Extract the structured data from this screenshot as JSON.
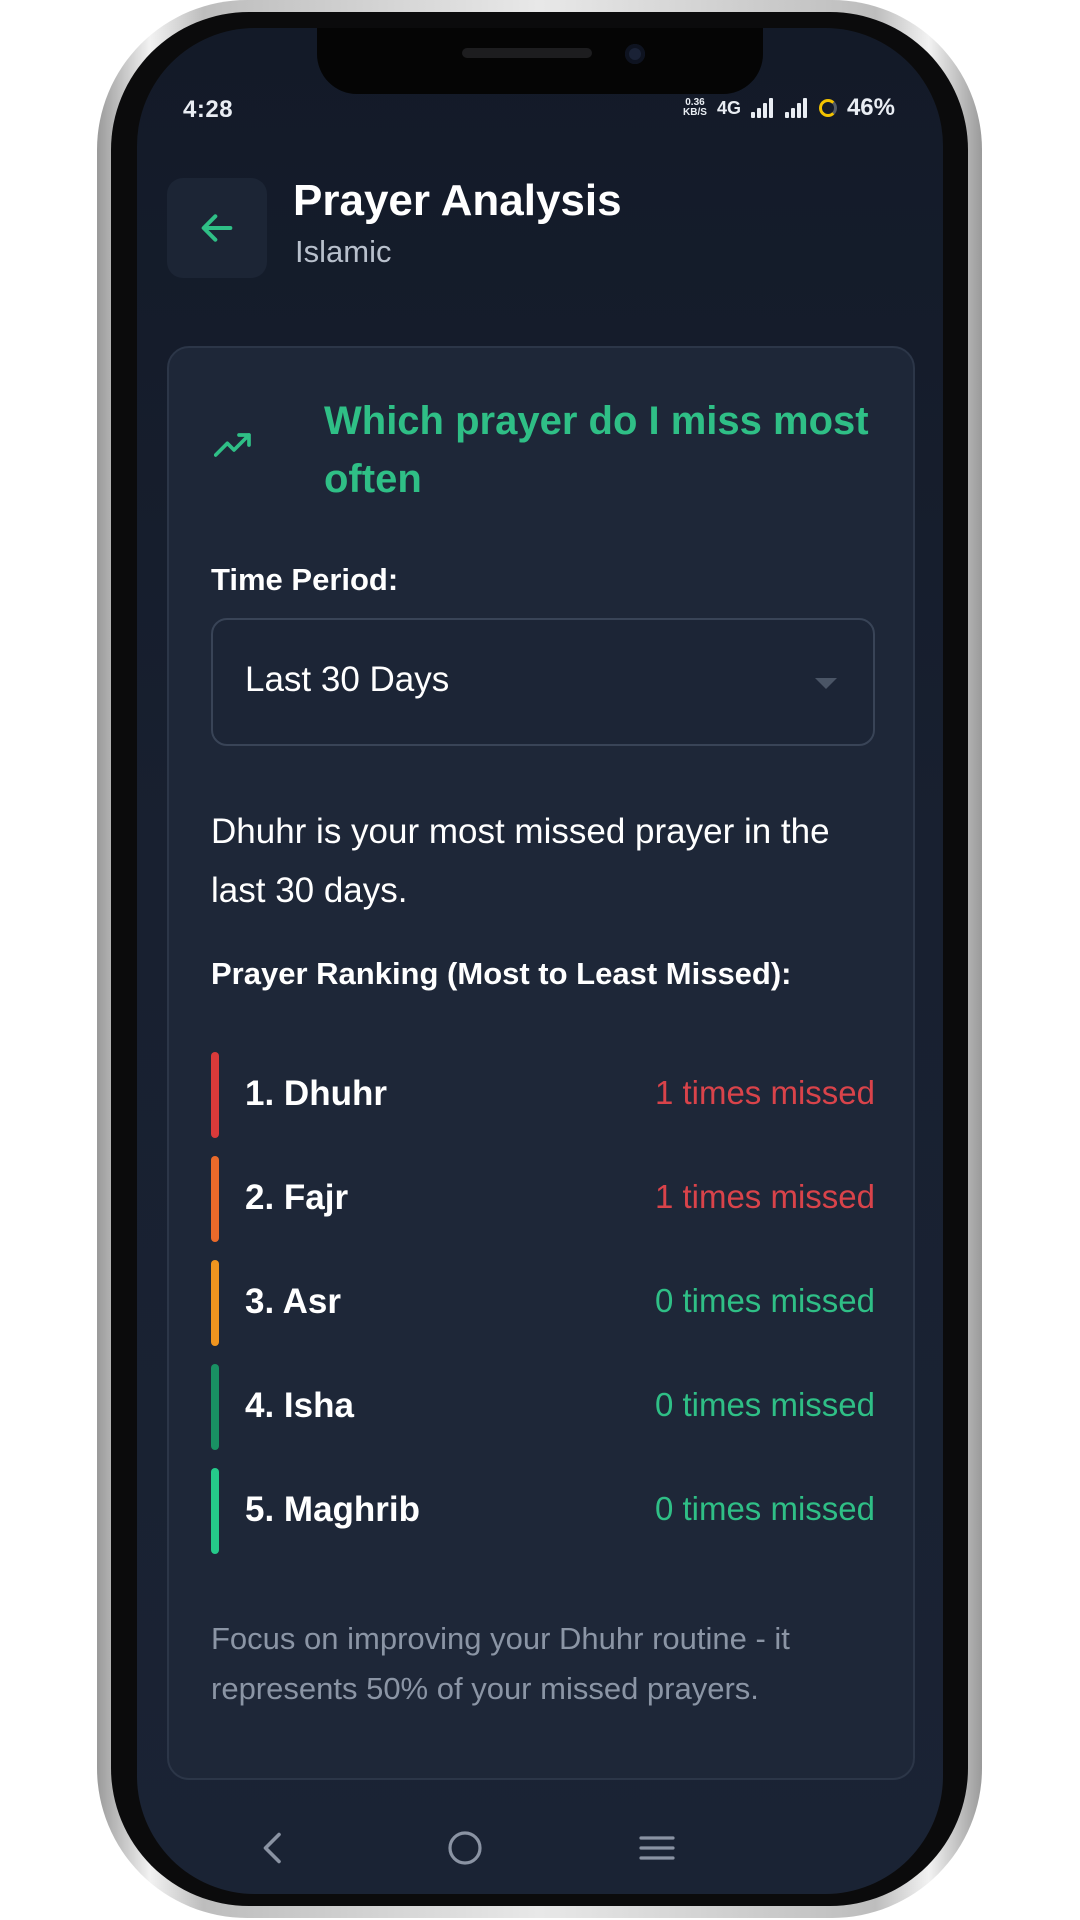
{
  "status_bar": {
    "time": "4:28",
    "net_speed_top": "0.36",
    "net_speed_bottom": "KB/S",
    "network": "4G",
    "battery": "46%"
  },
  "header": {
    "title": "Prayer Analysis",
    "subtitle": "Islamic"
  },
  "card": {
    "title": "Which prayer do I miss most often",
    "period_label": "Time Period:",
    "period_value": "Last 30 Days",
    "summary": "Dhuhr is your most missed prayer in the last 30 days.",
    "ranking_label": "Prayer Ranking (Most to Least Missed):",
    "ranking": [
      {
        "name": "1. Dhuhr",
        "count": "1 times missed",
        "bar_color": "#d93a3a",
        "count_color": "#d9434a"
      },
      {
        "name": "2. Fajr",
        "count": "1 times missed",
        "bar_color": "#ea6a2a",
        "count_color": "#d9434a"
      },
      {
        "name": "3. Asr",
        "count": "0 times missed",
        "bar_color": "#f0951f",
        "count_color": "#2fbf86"
      },
      {
        "name": "4. Isha",
        "count": "0 times missed",
        "bar_color": "#199063",
        "count_color": "#2fbf86"
      },
      {
        "name": "5. Maghrib",
        "count": "0 times missed",
        "bar_color": "#25c98a",
        "count_color": "#2fbf86"
      }
    ],
    "tip": "Focus on improving your Dhuhr routine - it represents 50% of your missed prayers."
  },
  "colors": {
    "accent": "#2fbf86",
    "background": "#182030",
    "card": "#1e2738"
  },
  "icons": {
    "back": "arrow-left-icon",
    "trend": "trending-up-icon",
    "dropdown": "caret-down-icon",
    "nav_back": "chevron-left-icon",
    "nav_home": "circle-home-icon",
    "nav_menu": "menu-lines-icon"
  }
}
